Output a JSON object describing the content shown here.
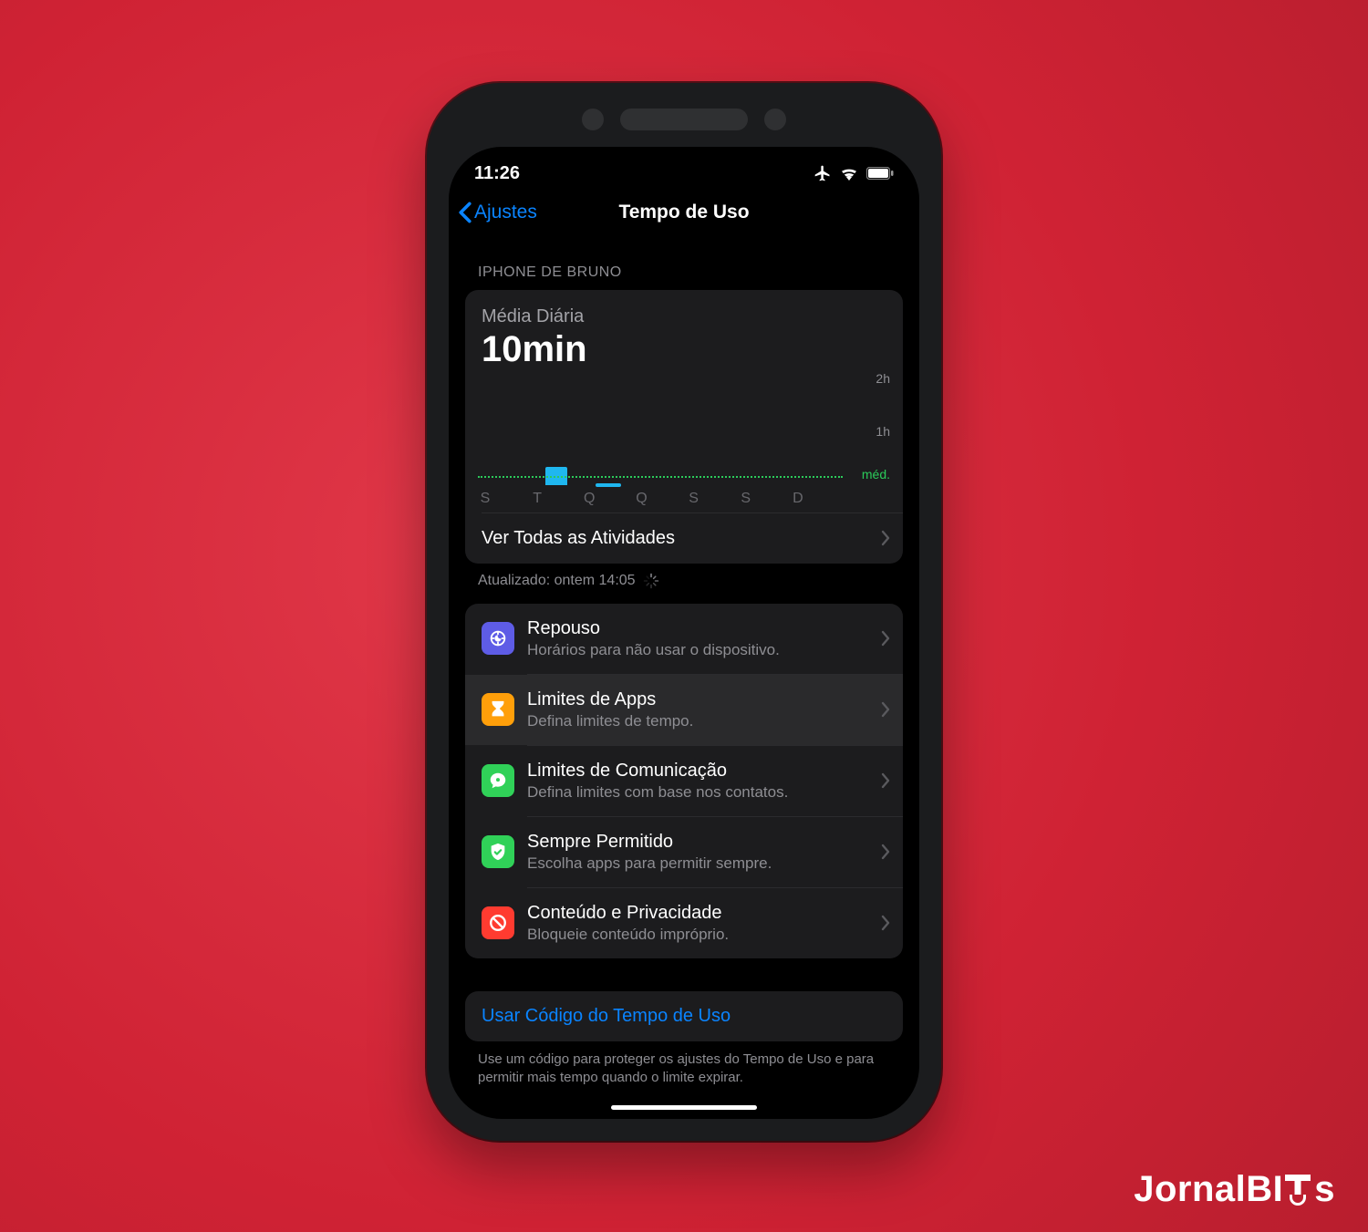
{
  "brand": "JornalBITs",
  "status": {
    "time": "11:26"
  },
  "nav": {
    "back": "Ajustes",
    "title": "Tempo de Uso"
  },
  "section_header": "IPHONE DE BRUNO",
  "summary": {
    "label": "Média Diária",
    "value": "10min",
    "see_all": "Ver Todas as Atividades",
    "updated": "Atualizado: ontem 14:05"
  },
  "options": [
    {
      "icon": "moon",
      "color": "#5E5CE6",
      "title": "Repouso",
      "sub": "Horários para não usar o dispositivo."
    },
    {
      "icon": "hourglass",
      "color": "#FF9F0A",
      "title": "Limites de Apps",
      "sub": "Defina limites de tempo.",
      "selected": true
    },
    {
      "icon": "bubble",
      "color": "#30D158",
      "title": "Limites de Comunicação",
      "sub": "Defina limites com base nos contatos."
    },
    {
      "icon": "check",
      "color": "#30D158",
      "title": "Sempre Permitido",
      "sub": "Escolha apps para permitir sempre."
    },
    {
      "icon": "nosign",
      "color": "#FF3B30",
      "title": "Conteúdo e Privacidade",
      "sub": "Bloqueie conteúdo impróprio."
    }
  ],
  "code_link": "Usar Código do Tempo de Uso",
  "code_note": "Use um código para proteger os ajustes do Tempo de Uso e para permitir mais tempo quando o limite expirar.",
  "chart_data": {
    "type": "bar",
    "title": "Média Diária",
    "categories": [
      "S",
      "T",
      "Q",
      "Q",
      "S",
      "S",
      "D"
    ],
    "values": [
      0,
      20,
      3,
      0,
      0,
      0,
      0
    ],
    "average_minutes": 10,
    "ylabel": "",
    "ylim_minutes": [
      0,
      120
    ],
    "yticks": [
      {
        "minutes": 120,
        "label": "2h"
      },
      {
        "minutes": 60,
        "label": "1h"
      }
    ],
    "average_label": "méd."
  }
}
